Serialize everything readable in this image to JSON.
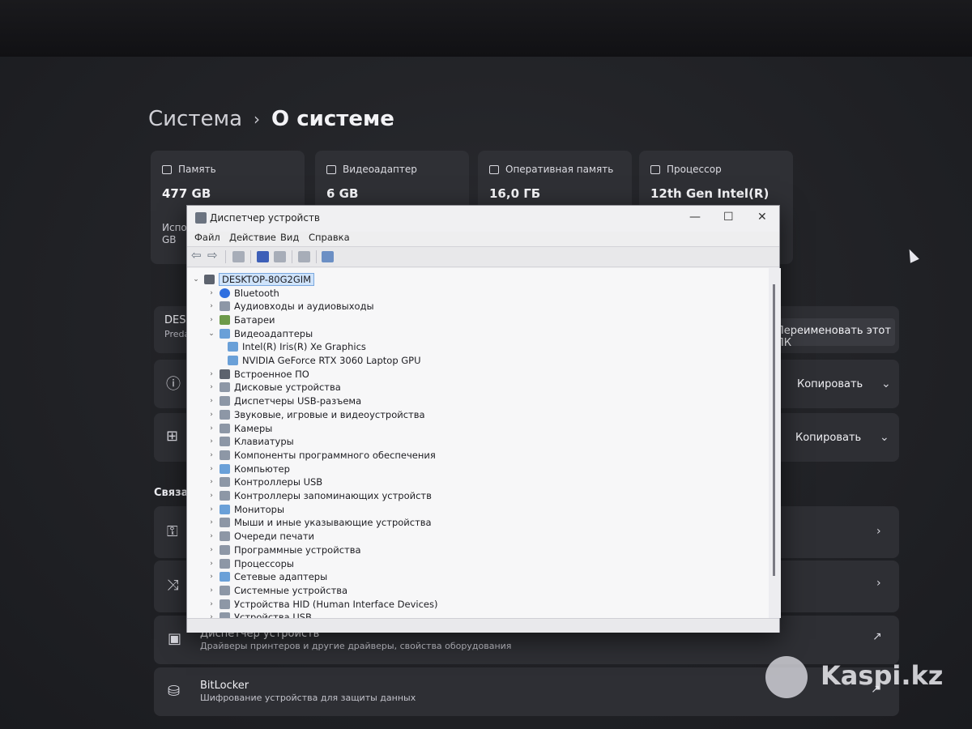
{
  "breadcrumb": {
    "parent": "Система",
    "separator": "›",
    "current": "О системе"
  },
  "spec_cards": [
    {
      "label": "Память",
      "value": "477 GB",
      "sub": "Испо",
      "sub2": "GB"
    },
    {
      "label": "Видеоадаптер",
      "value": "6 GB"
    },
    {
      "label": "Оперативная память",
      "value": "16,0 ГБ"
    },
    {
      "label": "Процессор",
      "value": "12th Gen Intel(R)"
    }
  ],
  "device_section": {
    "name_partial": "DESK",
    "sub_partial": "Preda",
    "rename_button": "Переименовать этот ПК"
  },
  "copy_rows": [
    {
      "copy_label": "Копировать"
    },
    {
      "copy_label": "Копировать"
    }
  ],
  "related_title": "Связан",
  "related_rows": [
    {
      "title": "Диспетчер устройств",
      "sub": "Драйверы принтеров и другие драйверы, свойства оборудования"
    },
    {
      "title": "BitLocker",
      "sub": "Шифрование устройства для защиты данных"
    }
  ],
  "device_manager": {
    "title": "Диспетчер устройств",
    "controls": {
      "minimize": "—",
      "maximize": "☐",
      "close": "✕"
    },
    "menu": [
      "Файл",
      "Действие",
      "Вид",
      "Справка"
    ],
    "root": "DESKTOP-80G2GIM",
    "tree": [
      {
        "label": "Bluetooth",
        "icon": "bluetooth-icon",
        "expanded": false
      },
      {
        "label": "Аудиовходы и аудиовыходы",
        "icon": "audio-icon",
        "expanded": false
      },
      {
        "label": "Батареи",
        "icon": "battery-icon",
        "expanded": false
      },
      {
        "label": "Видеоадаптеры",
        "icon": "display-adapter-icon",
        "expanded": true,
        "children": [
          "Intel(R) Iris(R) Xe Graphics",
          "NVIDIA GeForce RTX 3060 Laptop GPU"
        ]
      },
      {
        "label": "Встроенное ПО",
        "icon": "firmware-icon",
        "expanded": false
      },
      {
        "label": "Дисковые устройства",
        "icon": "disk-icon",
        "expanded": false
      },
      {
        "label": "Диспетчеры USB-разъема",
        "icon": "usb-icon",
        "expanded": false
      },
      {
        "label": "Звуковые, игровые и видеоустройства",
        "icon": "sound-icon",
        "expanded": false
      },
      {
        "label": "Камеры",
        "icon": "camera-icon",
        "expanded": false
      },
      {
        "label": "Клавиатуры",
        "icon": "keyboard-icon",
        "expanded": false
      },
      {
        "label": "Компоненты программного обеспечения",
        "icon": "software-icon",
        "expanded": false
      },
      {
        "label": "Компьютер",
        "icon": "computer-icon",
        "expanded": false
      },
      {
        "label": "Контроллеры USB",
        "icon": "usb-icon",
        "expanded": false
      },
      {
        "label": "Контроллеры запоминающих устройств",
        "icon": "storage-icon",
        "expanded": false
      },
      {
        "label": "Мониторы",
        "icon": "monitor-icon",
        "expanded": false
      },
      {
        "label": "Мыши и иные указывающие устройства",
        "icon": "mouse-icon",
        "expanded": false
      },
      {
        "label": "Очереди печати",
        "icon": "printer-icon",
        "expanded": false
      },
      {
        "label": "Программные устройства",
        "icon": "software-device-icon",
        "expanded": false
      },
      {
        "label": "Процессоры",
        "icon": "cpu-icon",
        "expanded": false
      },
      {
        "label": "Сетевые адаптеры",
        "icon": "network-icon",
        "expanded": false
      },
      {
        "label": "Системные устройства",
        "icon": "system-icon",
        "expanded": false
      },
      {
        "label": "Устройства HID (Human Interface Devices)",
        "icon": "hid-icon",
        "expanded": false
      },
      {
        "label": "Устройства USB",
        "icon": "usb-icon",
        "expanded": false
      }
    ]
  },
  "watermark": {
    "text": "Kaspi.kz"
  }
}
